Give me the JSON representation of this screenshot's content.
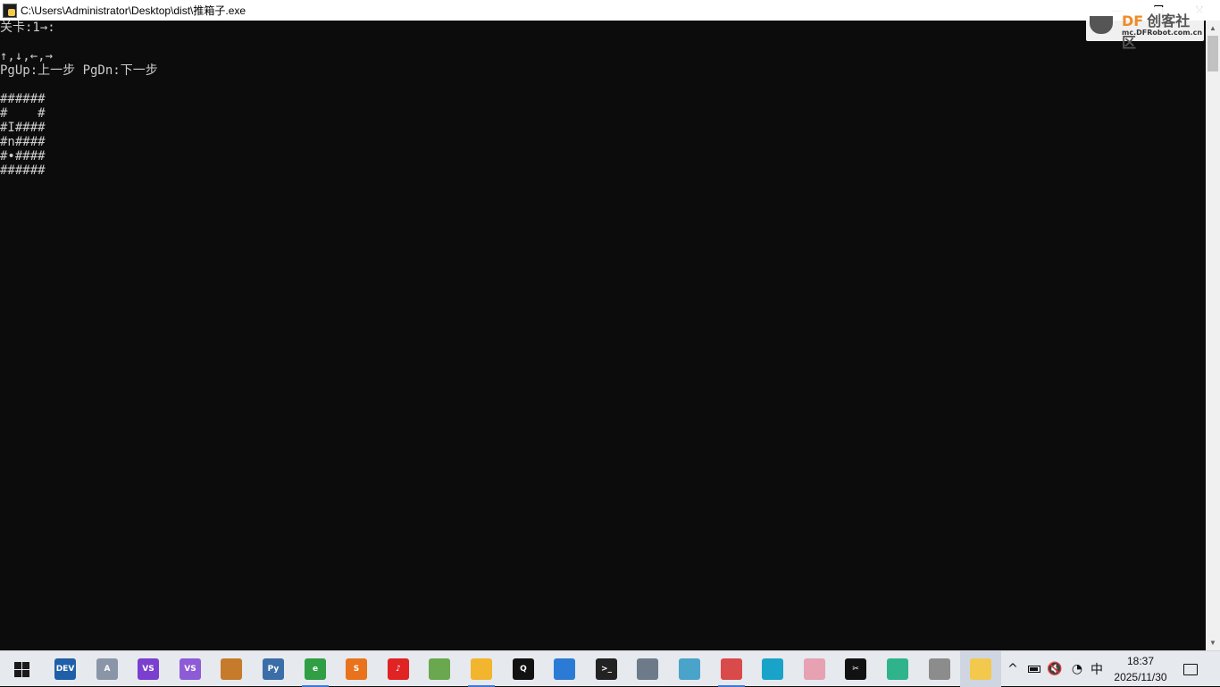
{
  "window": {
    "title": "C:\\Users\\Administrator\\Desktop\\dist\\推箱子.exe",
    "minimize_glyph": "—",
    "restore_glyph": "❐",
    "close_glyph": "✕"
  },
  "watermark": {
    "brand": "DF",
    "brand_cn": "创客社区",
    "url": "mc.DFRobot.com.cn"
  },
  "console": {
    "lines": [
      "关卡:1→:",
      "",
      "↑,↓,←,→",
      "PgUp:上一步 PgDn:下一步",
      "",
      "######",
      "#    #",
      "#I####",
      "#n####",
      "#•####",
      "######"
    ]
  },
  "scrollbar": {
    "up_glyph": "▲",
    "down_glyph": "▼"
  },
  "taskbar": {
    "apps": [
      {
        "name": "devcpp-icon",
        "color": "#1f5fa8",
        "label": "DEV"
      },
      {
        "name": "app-ab-icon",
        "color": "#8a96a8",
        "label": "A"
      },
      {
        "name": "visual-studio-preview-icon",
        "color": "#7b3fd0",
        "label": "VS"
      },
      {
        "name": "visual-studio-icon",
        "color": "#8e5bd6",
        "label": "VS"
      },
      {
        "name": "basket-app-icon",
        "color": "#c57b2a",
        "label": ""
      },
      {
        "name": "python-idle-icon",
        "color": "#3b6ea8",
        "label": "Py"
      },
      {
        "name": "chrome-icon",
        "color": "#2f9e44",
        "label": "e"
      },
      {
        "name": "sublime-text-icon",
        "color": "#e8731c",
        "label": "S"
      },
      {
        "name": "netease-music-icon",
        "color": "#e02323",
        "label": "♪"
      },
      {
        "name": "paint-app-icon",
        "color": "#6aa84f",
        "label": ""
      },
      {
        "name": "file-explorer-icon",
        "color": "#f2b52e",
        "label": ""
      },
      {
        "name": "qq-icon",
        "color": "#111111",
        "label": "Q"
      },
      {
        "name": "app-window-icon",
        "color": "#2b7bd6",
        "label": ""
      },
      {
        "name": "terminal-icon",
        "color": "#222222",
        "label": ">_"
      },
      {
        "name": "image-viewer-icon",
        "color": "#6c7a89",
        "label": ""
      },
      {
        "name": "notes-app-icon",
        "color": "#4aa3c8",
        "label": ""
      },
      {
        "name": "paint-brush-icon",
        "color": "#d94a4a",
        "label": ""
      },
      {
        "name": "vscode-like-icon",
        "color": "#1aa3c8",
        "label": ""
      },
      {
        "name": "avatar-app-icon",
        "color": "#e6a1b3",
        "label": ""
      },
      {
        "name": "capcut-icon",
        "color": "#111111",
        "label": "✂"
      },
      {
        "name": "monitor-app-icon",
        "color": "#2fb38a",
        "label": ""
      },
      {
        "name": "remote-app-icon",
        "color": "#8c8c8c",
        "label": ""
      },
      {
        "name": "sokoban-exe-icon",
        "color": "#f2c94c",
        "label": ""
      }
    ],
    "tray": {
      "chevron": "^",
      "ime": "中",
      "time": "18:37",
      "date": "2025/11/30"
    }
  }
}
